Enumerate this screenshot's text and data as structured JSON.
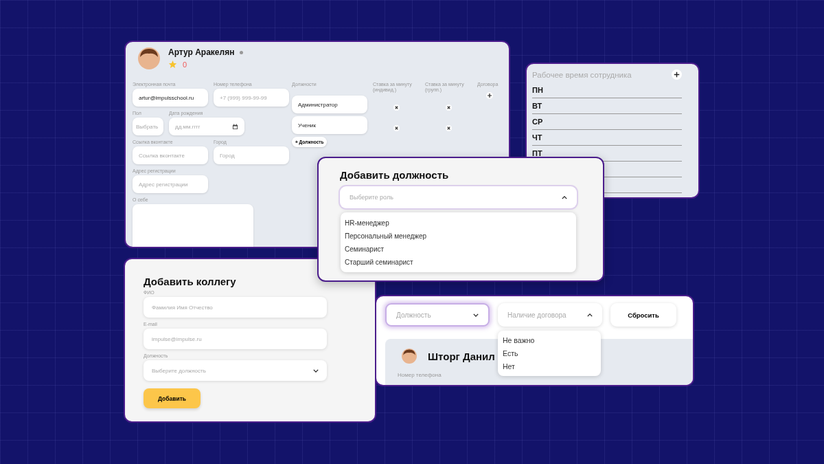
{
  "profile": {
    "name": "Артур Аракелян",
    "rating": "0",
    "form_rows": [
      [
        {
          "kind": "text",
          "label": "Электронная почта",
          "value": "artur@impulsschool.ru"
        },
        {
          "kind": "text",
          "label": "Номер телефона",
          "placeholder": "+7 (999) 999-99-99"
        }
      ],
      [
        {
          "kind": "select",
          "label": "Пол",
          "placeholder": "Выбрать"
        },
        {
          "kind": "date",
          "label": "Дата рождения",
          "placeholder": "дд.мм.гггг"
        }
      ],
      [
        {
          "kind": "text",
          "label": "Ссылка вконтакте",
          "placeholder": "Ссылка вконтакте"
        },
        {
          "kind": "text",
          "label": "Город",
          "placeholder": "Город"
        }
      ],
      [
        {
          "kind": "text",
          "label": "Адрес регистрации",
          "placeholder": "Адрес регистрации"
        }
      ],
      [
        {
          "kind": "textarea",
          "label": "О себе"
        }
      ]
    ],
    "positions": {
      "columns": [
        "Должности",
        "Ставка за минуту (индивид.)",
        "Ставка за минуту (групп.)",
        "Договора"
      ],
      "rows": [
        {
          "name": "Администратор"
        },
        {
          "name": "Ученик"
        }
      ],
      "add_button": "+ Должность"
    }
  },
  "schedule": {
    "title": "Рабочее время сотрудника",
    "days": [
      "ПН",
      "ВТ",
      "СР",
      "ЧТ",
      "ПТ"
    ]
  },
  "add_position": {
    "title": "Добавить должность",
    "select": {
      "placeholder": "Выберите роль",
      "expanded": true
    },
    "options": [
      "HR-менеджер",
      "Персональный менеджер",
      "Семинарист",
      "Старший семинарист"
    ]
  },
  "add_colleague": {
    "title": "Добавить коллегу",
    "fields": [
      {
        "kind": "text",
        "label": "ФИО",
        "placeholder": "Фамилия Имя Отчество"
      },
      {
        "kind": "text",
        "label": "E-mail",
        "placeholder": "impulse@impulse.ru"
      },
      {
        "kind": "select",
        "label": "Должность",
        "placeholder": "Выберите должность",
        "expanded": false
      }
    ],
    "button": "Добавить"
  },
  "filters": {
    "selects": [
      {
        "placeholder": "Должность",
        "expanded": false,
        "focused": true
      },
      {
        "placeholder": "Наличие договора",
        "expanded": true,
        "focused": false
      }
    ],
    "reset_button": "Сбросить",
    "options": [
      "Не важно",
      "Есть",
      "Нет"
    ],
    "employee": {
      "name": "Шторг Данил",
      "labels": [
        "Номер телефона"
      ]
    }
  }
}
